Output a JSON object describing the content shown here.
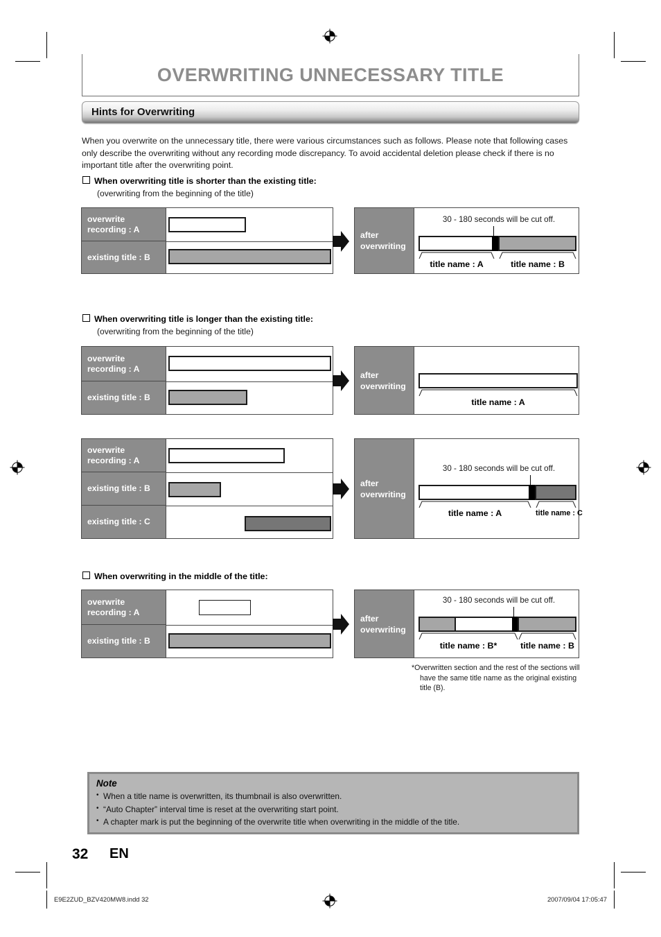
{
  "header": {
    "title": "OVERWRITING UNNECESSARY TITLE",
    "section_bar": "Hints for Overwriting"
  },
  "intro": "When you overwrite on the unnecessary title, there were various circumstances such as follows.  Please note that following cases only describe the overwriting without any recording mode discrepancy.  To avoid accidental deletion please check if there is no important title after the overwriting point.",
  "labels": {
    "overwrite_recording_a": "overwrite\nrecording : A",
    "overwrite_recording_a_l1": "overwrite",
    "overwrite_recording_a_l2": "recording : A",
    "existing_title_b": "existing title : B",
    "existing_title_c": "existing title : C",
    "after_overwriting_l1": "after",
    "after_overwriting_l2": "overwriting",
    "cutoff_note": "30 - 180 seconds will be cut off.",
    "title_name_a": "title name : A",
    "title_name_b": "title name : B",
    "title_name_c": "title name : C",
    "title_name_b_star": "title name : B*"
  },
  "cases": [
    {
      "heading": "When overwriting title is shorter than the existing title:",
      "sub": "(overwriting from the beginning of the title)"
    },
    {
      "heading": "When overwriting title is longer than the existing title:",
      "sub": "(overwriting from the beginning of the title)"
    },
    {
      "heading": "When overwriting in the middle of the title:",
      "sub": ""
    }
  ],
  "footnote": {
    "line1": "*Overwritten section and the rest of the sections will",
    "line2": "have the same title name as the original existing",
    "line3": "title (B)."
  },
  "note": {
    "title": "Note",
    "items": [
      "When a title name is overwritten, its thumbnail is also overwritten.",
      "“Auto Chapter” interval time is reset at the overwriting start point.",
      "A chapter mark is put the beginning of the overwrite title when overwriting in the middle of the title."
    ]
  },
  "page": {
    "number": "32",
    "lang": "EN"
  },
  "footer": {
    "left": "E9E2ZUD_BZV420MW8.indd   32",
    "right": "2007/09/04   17:05:47"
  },
  "colors": {
    "title_gray": "#8d8d8d",
    "label_cell": "#8c8c8c",
    "bar_b": "#a6a6a6",
    "bar_c": "#767676",
    "note_bg": "#b6b6b6",
    "note_border": "#8a8a8a",
    "outline": "#4a4a4a"
  },
  "chart_data": {
    "type": "diagram",
    "title": "Overwriting behavior timelines",
    "panels": [
      {
        "id": "case1-before",
        "rows": [
          {
            "label": "overwrite recording : A",
            "bar": {
              "start_pct": 0,
              "width_pct": 47,
              "fill": "white"
            }
          },
          {
            "label": "existing title : B",
            "bar": {
              "start_pct": 0,
              "width_pct": 100,
              "fill": "#a6a6a6"
            }
          }
        ]
      },
      {
        "id": "case1-after",
        "annotation": "30 - 180 seconds will be cut off.",
        "segments": [
          {
            "width_pct": 47,
            "fill": "white",
            "name": "title name : A"
          },
          {
            "width_pct": 4,
            "fill": "#000000",
            "name": "cut-off"
          },
          {
            "width_pct": 49,
            "fill": "#a6a6a6",
            "name": "title name : B"
          }
        ]
      },
      {
        "id": "case2-before",
        "rows": [
          {
            "label": "overwrite recording : A",
            "bar": {
              "start_pct": 0,
              "width_pct": 100,
              "fill": "white"
            }
          },
          {
            "label": "existing title : B",
            "bar": {
              "start_pct": 0,
              "width_pct": 48,
              "fill": "#a6a6a6"
            }
          }
        ]
      },
      {
        "id": "case2-after",
        "annotation": "",
        "segments": [
          {
            "width_pct": 100,
            "fill": "white",
            "name": "title name : A"
          }
        ]
      },
      {
        "id": "case3-before",
        "rows": [
          {
            "label": "overwrite recording : A",
            "bar": {
              "start_pct": 0,
              "width_pct": 71,
              "fill": "white"
            }
          },
          {
            "label": "existing title : B",
            "bar": {
              "start_pct": 0,
              "width_pct": 31,
              "fill": "#a6a6a6"
            }
          },
          {
            "label": "existing title : C",
            "bar": {
              "start_pct": 32,
              "width_pct": 68,
              "fill": "#767676"
            }
          }
        ]
      },
      {
        "id": "case3-after",
        "annotation": "30 - 180 seconds will be cut off.",
        "segments": [
          {
            "width_pct": 69,
            "fill": "white",
            "name": "title name : A"
          },
          {
            "width_pct": 4,
            "fill": "#000000",
            "name": "cut-off"
          },
          {
            "width_pct": 27,
            "fill": "#767676",
            "name": "title name : C"
          }
        ]
      },
      {
        "id": "case4-before",
        "rows": [
          {
            "label": "overwrite recording : A",
            "bar": {
              "start_pct": 24,
              "width_pct": 32,
              "fill": "white"
            }
          },
          {
            "label": "existing title : B",
            "bar": {
              "start_pct": 0,
              "width_pct": 100,
              "fill": "#a6a6a6"
            }
          }
        ]
      },
      {
        "id": "case4-after",
        "annotation": "30 - 180 seconds will be cut off.",
        "segments": [
          {
            "width_pct": 24,
            "fill": "#a6a6a6",
            "name": "title name : B*"
          },
          {
            "width_pct": 33,
            "fill": "white",
            "name": "title name : B*"
          },
          {
            "width_pct": 4,
            "fill": "#000000",
            "name": "cut-off"
          },
          {
            "width_pct": 39,
            "fill": "#a6a6a6",
            "name": "title name : B"
          }
        ]
      }
    ]
  }
}
